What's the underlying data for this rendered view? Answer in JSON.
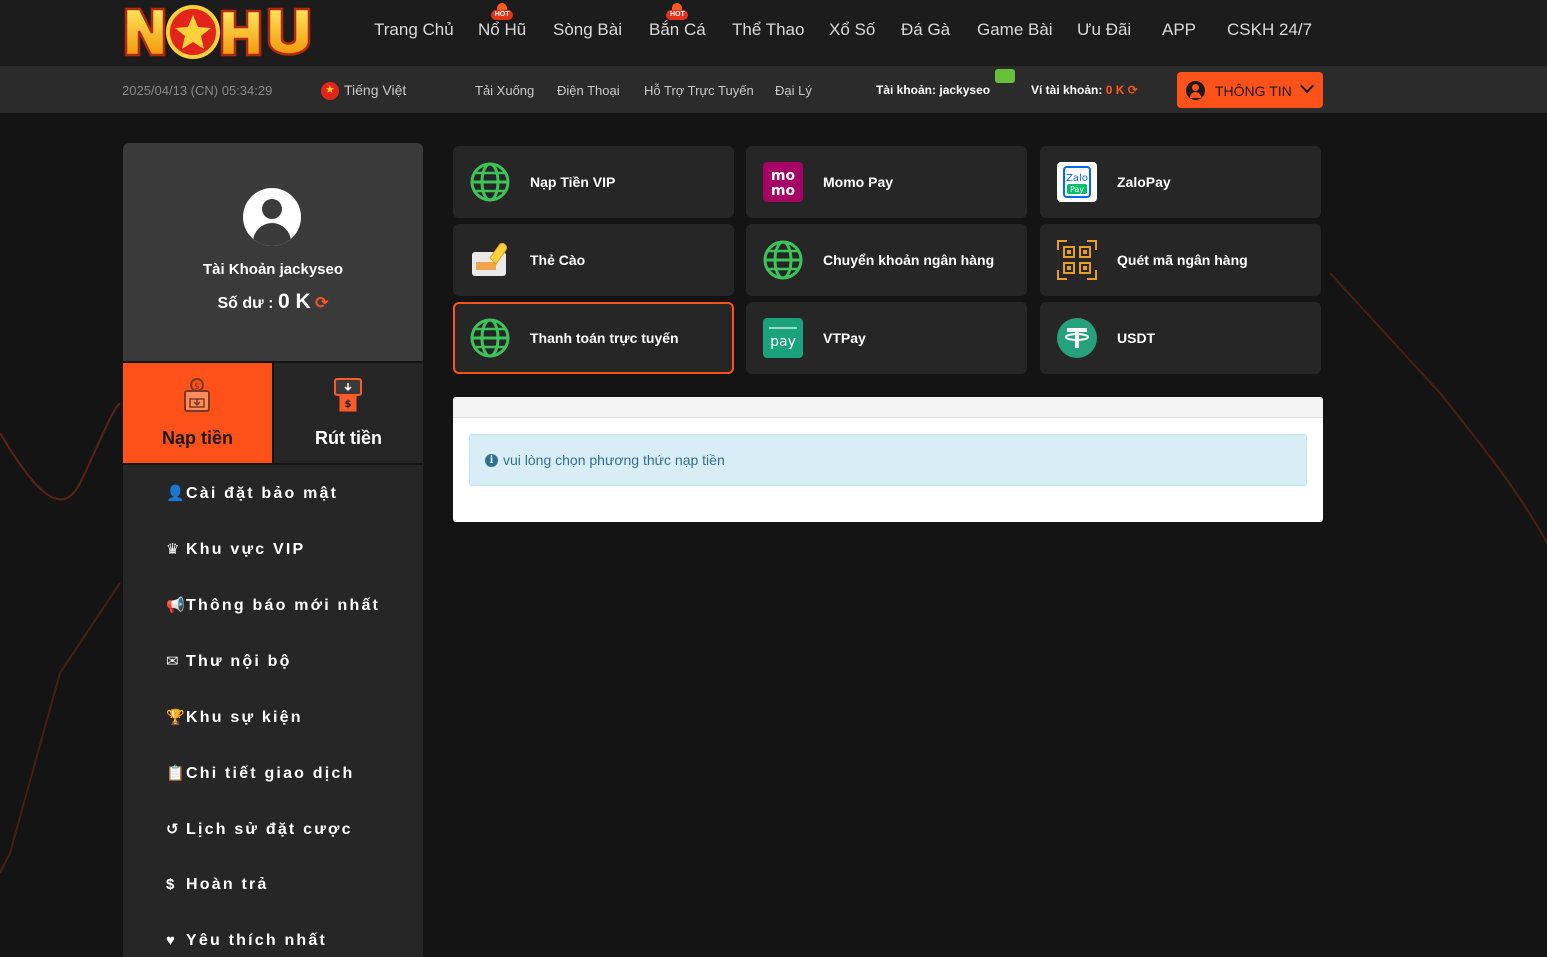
{
  "nav": {
    "items": [
      {
        "label": "Trang Chủ",
        "hot": false
      },
      {
        "label": "Nổ Hũ",
        "hot": true
      },
      {
        "label": "Sòng Bài",
        "hot": false
      },
      {
        "label": "Bắn Cá",
        "hot": true
      },
      {
        "label": "Thể Thao",
        "hot": false
      },
      {
        "label": "Xổ Số",
        "hot": false
      },
      {
        "label": "Đá Gà",
        "hot": false
      },
      {
        "label": "Game Bài",
        "hot": false
      },
      {
        "label": "Ưu Đãi",
        "hot": false
      },
      {
        "label": "APP",
        "hot": false
      },
      {
        "label": "CSKH 24/7",
        "hot": false
      }
    ],
    "hot_label": "HOT",
    "logo_text": "NOHU"
  },
  "subbar": {
    "datetime": "2025/04/13 (CN) 05:34:29",
    "language": "Tiếng Việt",
    "links": [
      "Tải Xuống",
      "Điện Thoại",
      "Hỗ Trợ Trực Tuyến",
      "Đại Lý"
    ],
    "account_label": "Tài khoản:",
    "account_name": "jackyseo",
    "wallet_label": "Ví tài khoản:",
    "wallet_value": "0 K",
    "info_button": "THÔNG TIN"
  },
  "profile": {
    "account_prefix": "Tài Khoản",
    "username": "jackyseo",
    "balance_label": "Số dư :",
    "balance_value": "0 K"
  },
  "tabs": {
    "deposit": "Nạp tiền",
    "withdraw": "Rút tiền"
  },
  "menu": [
    {
      "label": "Cài đặt bảo mật",
      "icon": "user-lock-icon"
    },
    {
      "label": "Khu vực VIP",
      "icon": "vip-crown-icon"
    },
    {
      "label": "Thông báo mới nhất",
      "icon": "megaphone-icon"
    },
    {
      "label": "Thư nội bộ",
      "icon": "envelope-icon"
    },
    {
      "label": "Khu sự kiện",
      "icon": "trophy-icon"
    },
    {
      "label": "Chi tiết giao dịch",
      "icon": "clipboard-icon"
    },
    {
      "label": "Lịch sử đặt cược",
      "icon": "history-icon"
    },
    {
      "label": "Hoàn trả",
      "icon": "dollar-coin-icon"
    },
    {
      "label": "Yêu thích nhất",
      "icon": "heart-icon"
    }
  ],
  "payments": [
    {
      "label": "Nạp Tiền VIP",
      "icon": "globe-icon"
    },
    {
      "label": "Momo Pay",
      "icon": "momo-icon",
      "icon_text": "mo mo"
    },
    {
      "label": "ZaloPay",
      "icon": "zalopay-icon",
      "icon_text": "Zalo Pay"
    },
    {
      "label": "Thẻ Cào",
      "icon": "scratch-card-icon"
    },
    {
      "label": "Chuyển khoản ngân hàng",
      "icon": "globe-icon"
    },
    {
      "label": "Quét mã ngân hàng",
      "icon": "qr-code-icon"
    },
    {
      "label": "Thanh toán trực tuyến",
      "icon": "globe-icon",
      "selected": true
    },
    {
      "label": "VTPay",
      "icon": "vtpay-icon",
      "icon_text": "pay"
    },
    {
      "label": "USDT",
      "icon": "tether-icon",
      "icon_text": "₮"
    }
  ],
  "notice": "vui lòng chọn phương thức nạp tiền",
  "colors": {
    "accent": "#ff5119",
    "globe": "#3ec35a",
    "momo": "#a50064",
    "zalopay": "#0068ff",
    "vtpay": "#1aa37a",
    "usdt": "#26a17b"
  }
}
